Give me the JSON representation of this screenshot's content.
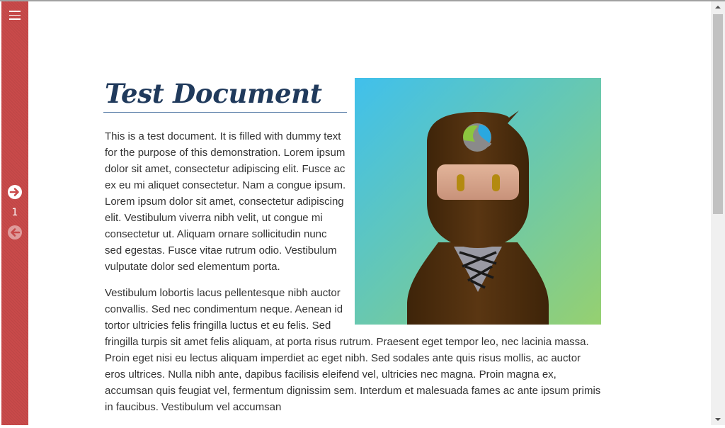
{
  "sidebar": {
    "page_number": "1",
    "icons": [
      "menu-icon",
      "arrow-right-circle-icon",
      "arrow-left-circle-icon"
    ]
  },
  "document": {
    "title": "Test Document",
    "paragraph_1": "This is a test document. It is filled with dummy text for the purpose of this demonstration. Lorem ipsum dolor sit amet, consectetur adipiscing elit. Fusce ac ex eu mi aliquet consectetur. Nam a congue ipsum. Lorem ipsum dolor sit amet, consectetur adipiscing elit. Vestibulum viverra nibh velit, ut congue mi consectetur ut. Aliquam ornare sollicitudin nunc sed egestas. Fusce vitae rutrum odio. Vestibulum vulputate dolor sed elementum porta.",
    "paragraph_2": "Vestibulum lobortis lacus pellentesque nibh auctor convallis. Sed nec condimentum neque. Aenean id tortor ultricies felis fringilla luctus et eu felis. Sed fringilla turpis sit amet felis aliquam, at porta risus rutrum. Praesent eget tempor leo, nec lacinia massa. Proin eget nisi eu lectus aliquam imperdiet ac eget nibh. Sed sodales ante quis risus mollis, ac auctor eros ultrices. Nulla nibh ante, dapibus facilisis eleifend vel, ultricies nec magna. Proin magna ex, accumsan quis feugiat vel, fermentum dignissim sem. Interdum et malesuada fames ac ante ipsum primis in faucibus. Vestibulum vel accumsan"
  },
  "colors": {
    "sidebar": "#c94a4a",
    "title": "#203a5c",
    "body_text": "#333333",
    "title_rule": "#5a7fa8"
  }
}
